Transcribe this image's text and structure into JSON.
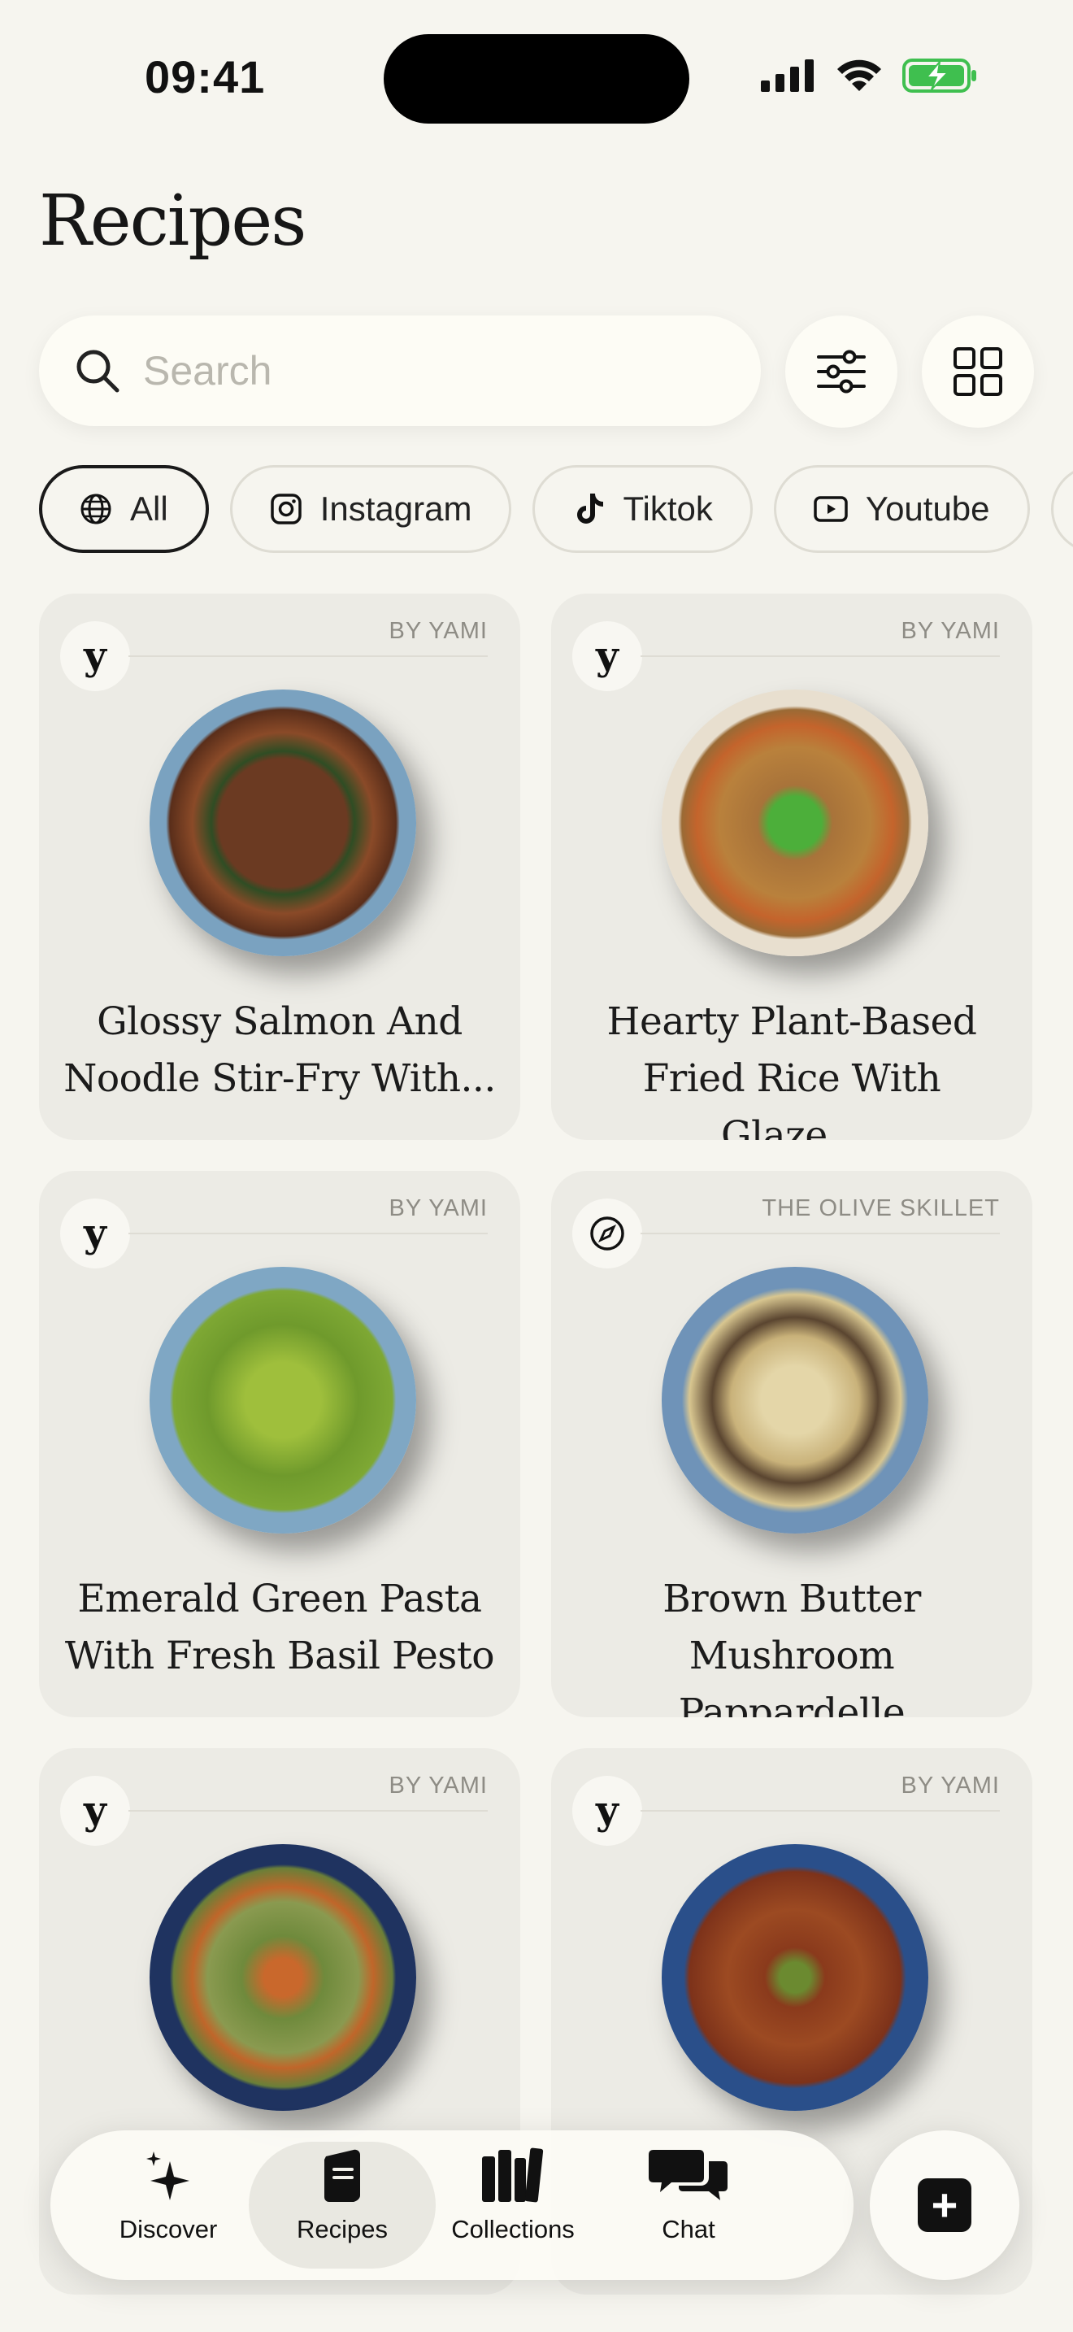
{
  "status": {
    "time": "09:41"
  },
  "header": {
    "title": "Recipes"
  },
  "search": {
    "placeholder": "Search"
  },
  "filters": [
    {
      "label": "All",
      "icon": "globe-icon",
      "active": true
    },
    {
      "label": "Instagram",
      "icon": "instagram-icon",
      "active": false
    },
    {
      "label": "Tiktok",
      "icon": "tiktok-icon",
      "active": false
    },
    {
      "label": "Youtube",
      "icon": "youtube-icon",
      "active": false
    }
  ],
  "recipes": [
    {
      "source": "BY YAMI",
      "badge": "y",
      "title_line1": "Glossy Salmon And",
      "title_line2": "Noodle Stir-Fry With...",
      "bowl": "#7aa2c0"
    },
    {
      "source": "BY YAMI",
      "badge": "y",
      "title_line1": "Hearty Plant-Based",
      "title_line2": "Fried Rice With Glaze...",
      "bowl": "#e8dfcf"
    },
    {
      "source": "BY YAMI",
      "badge": "y",
      "title_line1": "Emerald Green Pasta",
      "title_line2": "With Fresh Basil Pesto",
      "bowl": "#d58a4a"
    },
    {
      "source": "THE OLIVE SKILLET",
      "badge": "compass",
      "title_line1": "Brown Butter Mushroom",
      "title_line2": "Pappardelle",
      "bowl": "#6f93b8"
    },
    {
      "source": "BY YAMI",
      "badge": "y",
      "title_line1": "",
      "title_line2": "",
      "bowl": "#1f3360"
    },
    {
      "source": "BY YAMI",
      "badge": "y",
      "title_line1": "",
      "title_line2": "",
      "bowl": "#2a4f8a"
    }
  ],
  "nav": {
    "tabs": [
      {
        "label": "Discover",
        "icon": "sparkles-icon"
      },
      {
        "label": "Recipes",
        "icon": "recipe-book-icon",
        "active": true
      },
      {
        "label": "Collections",
        "icon": "books-icon"
      },
      {
        "label": "Chat",
        "icon": "chat-bubbles-icon"
      }
    ],
    "add_icon": "plus-square-icon"
  },
  "colors": {
    "background": "#f6f5ef",
    "card": "#ecebe5",
    "accent": "#111111"
  }
}
